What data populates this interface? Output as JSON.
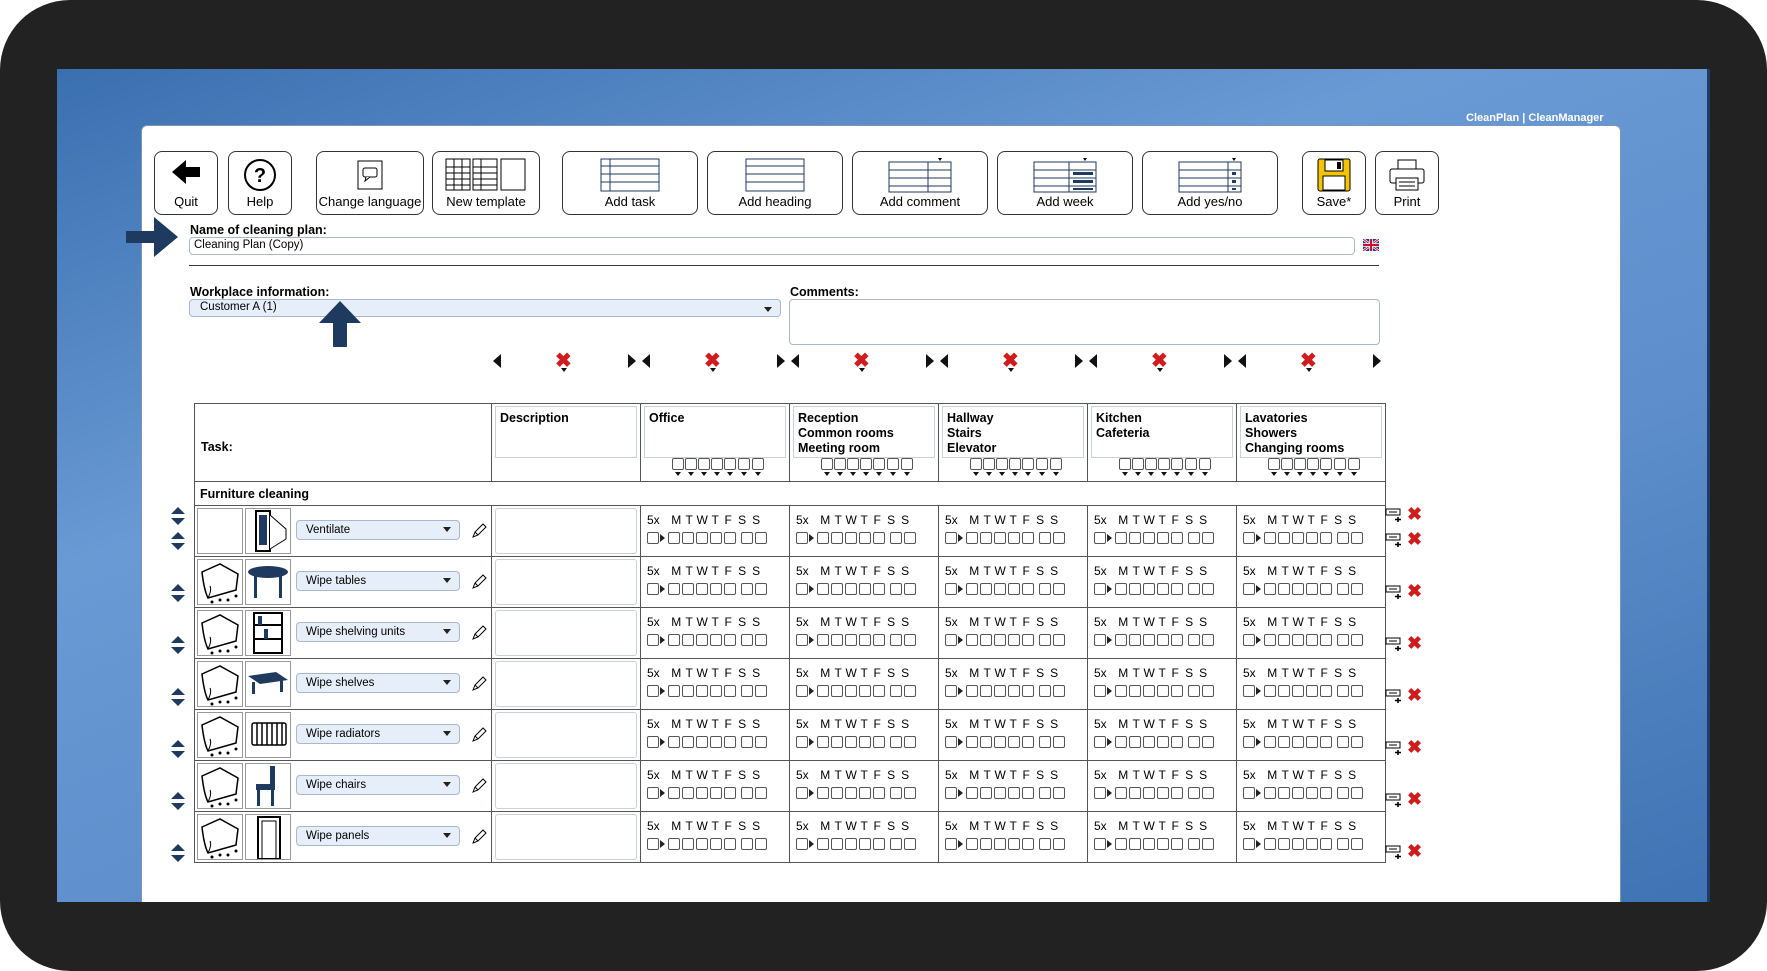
{
  "brand": "CleanPlan | CleanManager",
  "toolbar": {
    "quit": "Quit",
    "help": "Help",
    "change_language": "Change language",
    "new_template": "New template",
    "add_task": "Add task",
    "add_heading": "Add heading",
    "add_comment": "Add comment",
    "add_week": "Add week",
    "add_yesno": "Add yes/no",
    "save": "Save*",
    "print": "Print"
  },
  "plan": {
    "name_label": "Name of cleaning plan:",
    "name_value": "Cleaning Plan (Copy)",
    "workplace_label": "Workplace information:",
    "workplace_value": "Customer A (1)",
    "comments_label": "Comments:"
  },
  "grid": {
    "task_header": "Task:",
    "columns": [
      {
        "lines": [
          "Description"
        ]
      },
      {
        "lines": [
          "Office"
        ]
      },
      {
        "lines": [
          "Reception",
          "Common rooms",
          "Meeting room"
        ]
      },
      {
        "lines": [
          "Hallway",
          "Stairs",
          "Elevator"
        ]
      },
      {
        "lines": [
          "Kitchen",
          "Cafeteria"
        ]
      },
      {
        "lines": [
          "Lavatories",
          "Showers",
          "Changing rooms"
        ]
      }
    ],
    "freq_label": "5x",
    "day_letters": [
      "M",
      "T",
      "W",
      "T",
      "F",
      "S",
      "S"
    ],
    "heading": "Furniture cleaning",
    "tasks": [
      {
        "label": "Ventilate",
        "icon1": "blank",
        "icon2": "window-icon"
      },
      {
        "label": "Wipe tables",
        "icon1": "wet-cloth-icon",
        "icon2": "table-icon"
      },
      {
        "label": "Wipe shelving units",
        "icon1": "wet-cloth-icon",
        "icon2": "shelving-icon"
      },
      {
        "label": "Wipe shelves",
        "icon1": "wet-cloth-icon",
        "icon2": "shelf-icon"
      },
      {
        "label": "Wipe radiators",
        "icon1": "wet-cloth-icon",
        "icon2": "radiator-icon"
      },
      {
        "label": "Wipe chairs",
        "icon1": "wet-cloth-icon",
        "icon2": "chair-icon"
      },
      {
        "label": "Wipe panels",
        "icon1": "wet-cloth-icon",
        "icon2": "door-panel-icon"
      }
    ]
  },
  "colors": {
    "accent_blue": "#1f3a5f",
    "delete_red": "#d01c1c",
    "select_bg": "#e6eef9"
  }
}
